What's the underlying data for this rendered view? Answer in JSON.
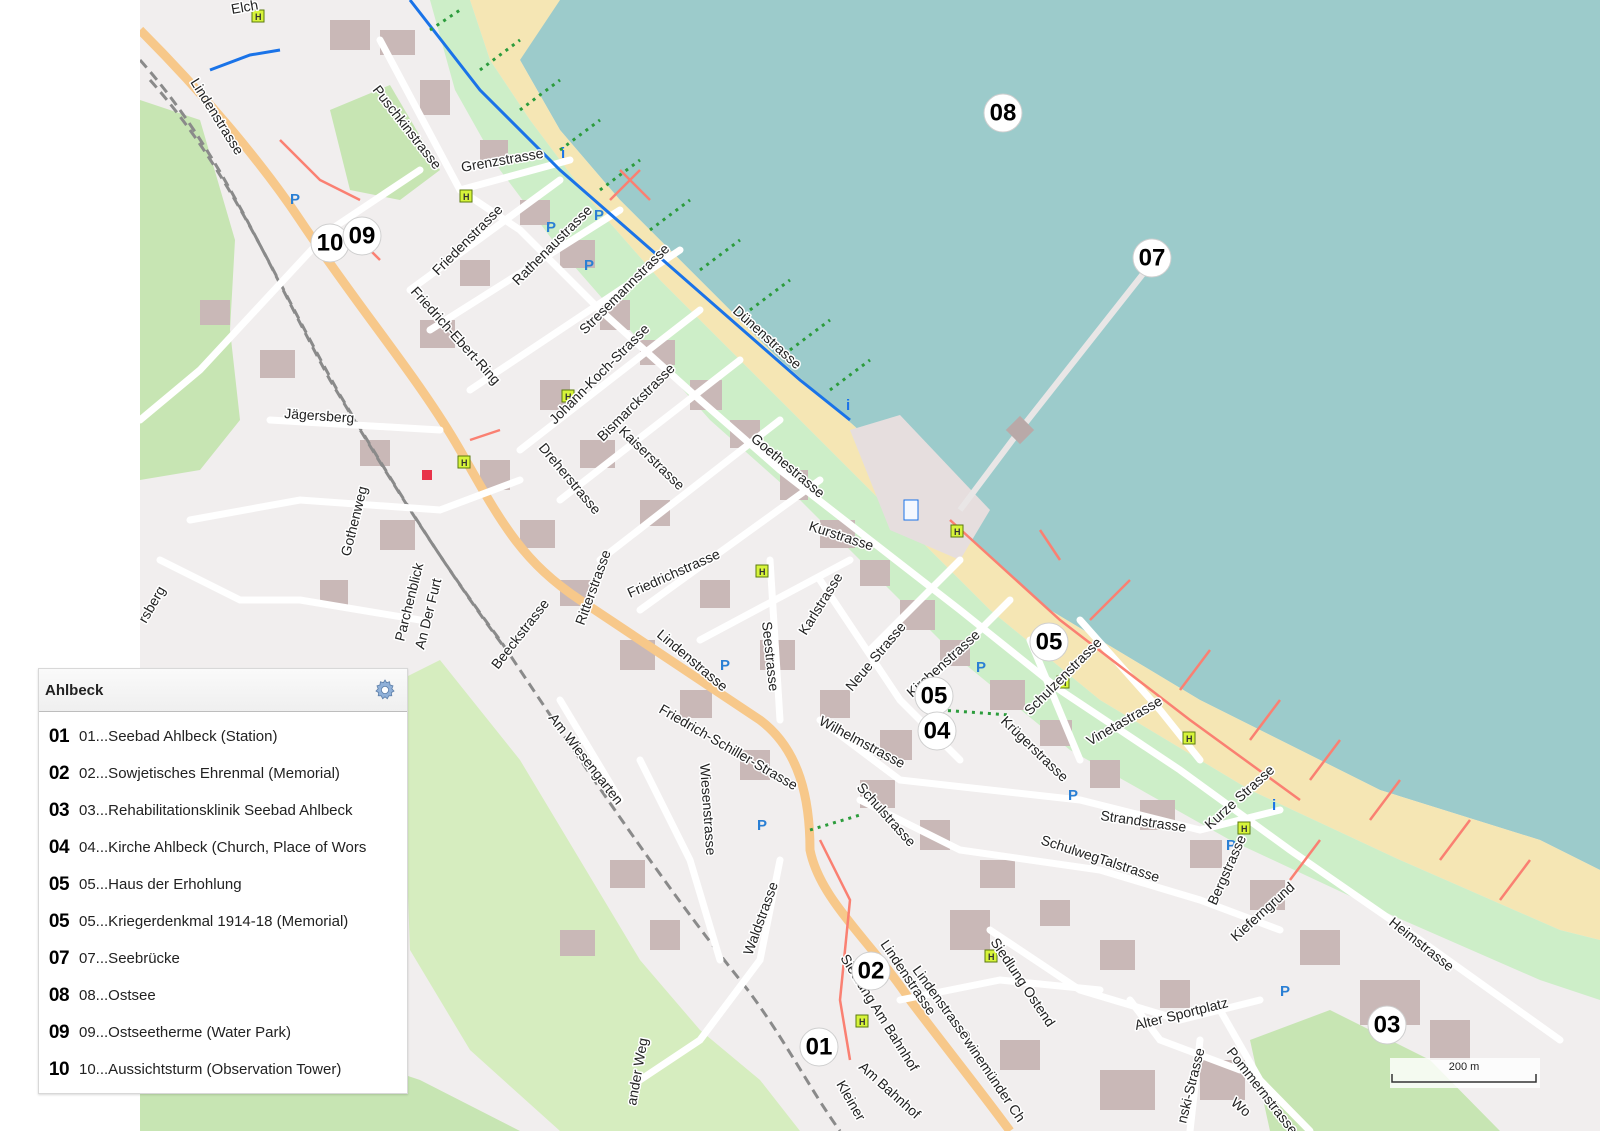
{
  "map": {
    "colors": {
      "sea": "#9ccbcb",
      "beach": "#f5e6b4",
      "dune": "#cdeec8",
      "land": "#f1eeee",
      "road": "#ffffff",
      "main_road": "#f7c88a",
      "building": "#c9b8b7",
      "forest": "#c7e5b3",
      "footway": "#fa8072",
      "promenade": "#1a73e8",
      "railway": "#8a8a8a"
    },
    "streets": {
      "s1": "Lindenstrasse",
      "s2": "Puschkinstrasse",
      "s3": "Grenzstrasse",
      "s4": "Friedenstrasse",
      "s5": "Rathenaustrasse",
      "s6": "Stresemannstrasse",
      "s7": "Friedrich-Ebert-Ring",
      "s8": "Johann-Koch-Strasse",
      "s9": "Bismarckstrasse",
      "s10": "Dünenstrasse",
      "s11": "Jägersberg",
      "s12": "Kaiserstrasse",
      "s13": "Goethestrasse",
      "s14": "Dreherstrasse",
      "s15": "Gothenweg",
      "s16": "Kurstrasse",
      "s17": "Friedrichstrasse",
      "s18": "Ritterstrasse",
      "s19": "Beeckstrasse",
      "s20": "Parchenblick",
      "s21": "An Der Furt",
      "s22": "Karlstrasse",
      "s23": "Seestrasse",
      "s24": "Lindenstrasse",
      "s25": "Neue Strasse",
      "s26": "Kirchenstrasse",
      "s27": "Schulzenstrasse",
      "s28": "Vinetastrasse",
      "s29": "Krügerstrasse",
      "s30": "Wilhelmstrasse",
      "s31": "Friedrich-Schiller-Strasse",
      "s32": "Am Wiesengarten",
      "s33": "Wiesenstrasse",
      "s34": "Schulstrasse",
      "s35": "Strandstrasse",
      "s36": "Kurze Strasse",
      "s37": "SchulwegTalstrasse",
      "s38": "Bergstrasse",
      "s39": "Kieferngrund",
      "s40": "Heimstrasse",
      "s41": "Waldstrasse",
      "s42": "Siedlung Ostend",
      "s43": "Lindenstrasse",
      "s44": "Siedlung Am Bahnhof",
      "s45": "Alter Sportplatz",
      "s46": "Swinemünder Ch",
      "s47": "Am Bahnhof",
      "s48": "Pommernstrasse",
      "s49": "Kleiner",
      "s50": "Lindenstrasse",
      "s51": "Elch",
      "s52": "rsberg",
      "s53": "ander Weg",
      "s54": "nski-Strasse",
      "s55": "Wo"
    },
    "markers": [
      {
        "id": "m08",
        "label": "08"
      },
      {
        "id": "m07",
        "label": "07"
      },
      {
        "id": "m10",
        "label": "10"
      },
      {
        "id": "m09",
        "label": "09"
      },
      {
        "id": "m05a",
        "label": "05"
      },
      {
        "id": "m05b",
        "label": "05"
      },
      {
        "id": "m04",
        "label": "04"
      },
      {
        "id": "m02",
        "label": "02"
      },
      {
        "id": "m01",
        "label": "01"
      },
      {
        "id": "m03",
        "label": "03"
      }
    ],
    "scale_label": "200 m",
    "parking_symbol": "P",
    "info_symbol": "i",
    "bus_symbol": "H"
  },
  "legend": {
    "title": "Ahlbeck",
    "settings_icon": "gear-icon",
    "items": [
      {
        "num": "01",
        "text": "01...Seebad Ahlbeck (Station)"
      },
      {
        "num": "02",
        "text": "02...Sowjetisches Ehrenmal (Memorial)"
      },
      {
        "num": "03",
        "text": "03...Rehabilitationsklinik Seebad Ahlbeck"
      },
      {
        "num": "04",
        "text": "04...Kirche Ahlbeck (Church, Place of Wors"
      },
      {
        "num": "05",
        "text": "05...Haus der Erhohlung"
      },
      {
        "num": "05",
        "text": "05...Kriegerdenkmal 1914-18 (Memorial)"
      },
      {
        "num": "07",
        "text": "07...Seebrücke"
      },
      {
        "num": "08",
        "text": "08...Ostsee"
      },
      {
        "num": "09",
        "text": "09...Ostseetherme (Water Park)"
      },
      {
        "num": "10",
        "text": "10...Aussichtsturm (Observation Tower)"
      }
    ]
  }
}
